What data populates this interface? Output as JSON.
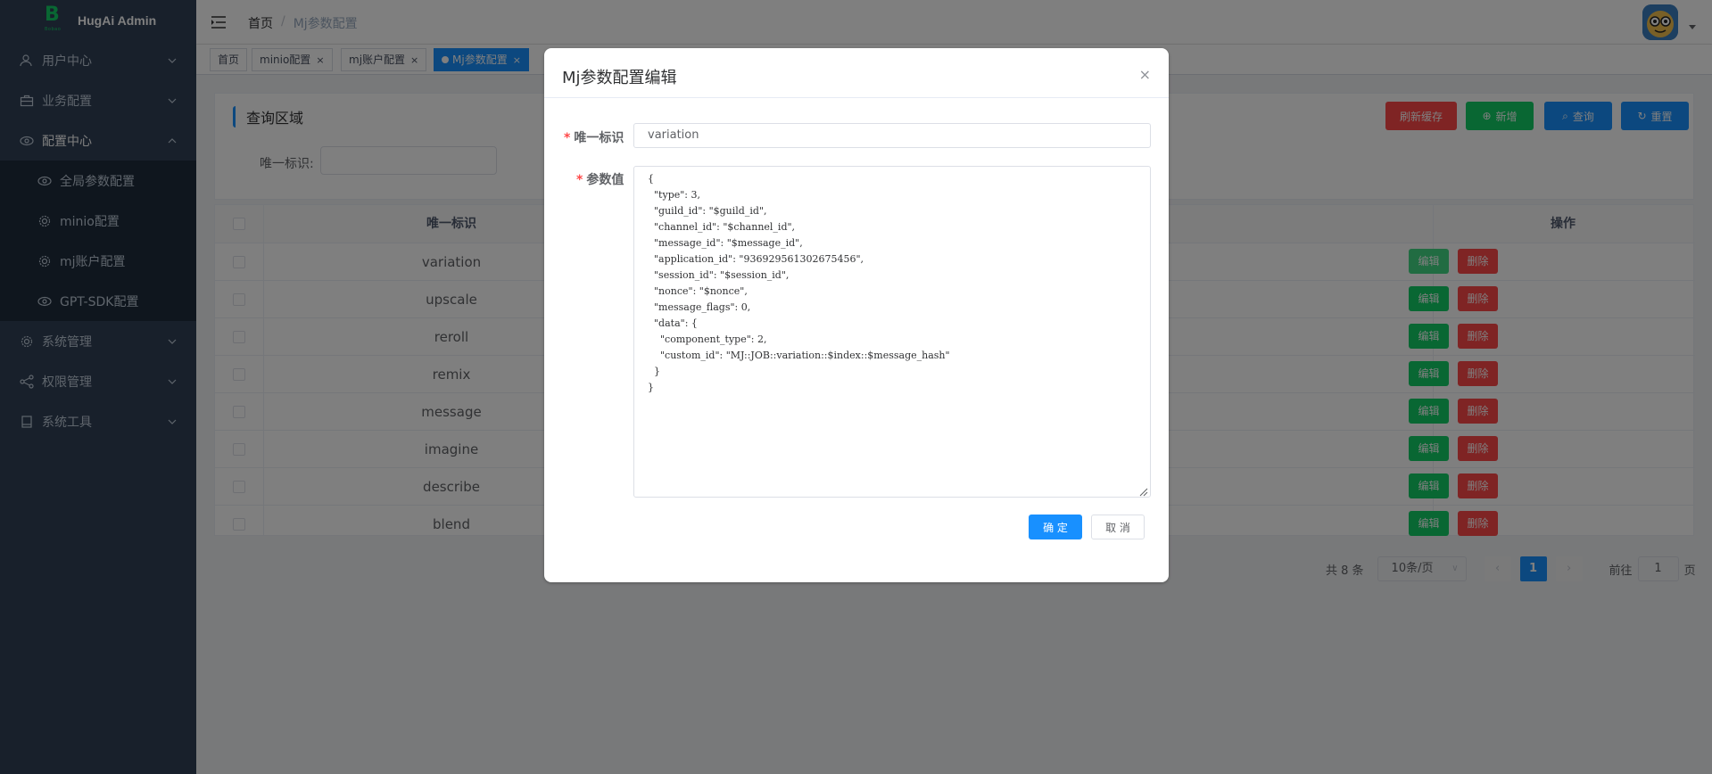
{
  "app": {
    "title": "HugAi Admin",
    "logo_letter": "B",
    "logo_sub": "Bobao"
  },
  "sidebar": {
    "items": [
      {
        "label": "用户中心",
        "icon": "user-icon"
      },
      {
        "label": "业务配置",
        "icon": "briefcase-icon"
      },
      {
        "label": "配置中心",
        "icon": "eye-icon"
      },
      {
        "label": "系统管理",
        "icon": "gear-icon"
      },
      {
        "label": "权限管理",
        "icon": "share-icon"
      },
      {
        "label": "系统工具",
        "icon": "printer-icon"
      }
    ],
    "config_sub": [
      {
        "label": "全局参数配置",
        "icon": "eye-icon"
      },
      {
        "label": "minio配置",
        "icon": "gear-icon"
      },
      {
        "label": "mj账户配置",
        "icon": "gear-icon"
      },
      {
        "label": "GPT-SDK配置",
        "icon": "eye-icon"
      }
    ]
  },
  "header": {
    "breadcrumb_home": "首页",
    "breadcrumb_sep": "/",
    "breadcrumb_current": "Mj参数配置"
  },
  "tags": [
    {
      "label": "首页"
    },
    {
      "label": "minio配置"
    },
    {
      "label": "mj账户配置"
    },
    {
      "label": "Mj参数配置"
    }
  ],
  "query": {
    "title": "查询区域",
    "label": "唯一标识:",
    "buttons": {
      "refresh": "刷新缓存",
      "add": "新增",
      "search": "查询",
      "reset": "重置"
    }
  },
  "table": {
    "headers": {
      "id": "唯一标识",
      "ops": "操作"
    },
    "edit_label": "编辑",
    "delete_label": "删除",
    "rows": [
      "variation",
      "upscale",
      "reroll",
      "remix",
      "message",
      "imagine",
      "describe",
      "blend"
    ]
  },
  "pagination": {
    "total": "共 8 条",
    "page_size": "10条/页",
    "current": "1",
    "goto_label": "前往",
    "goto_value": "1",
    "page_unit": "页"
  },
  "dialog": {
    "title": "Mj参数配置编辑",
    "id_label": "唯一标识",
    "id_value": "variation",
    "param_label": "参数值",
    "param_value": "{\n  \"type\": 3,\n  \"guild_id\": \"$guild_id\",\n  \"channel_id\": \"$channel_id\",\n  \"message_id\": \"$message_id\",\n  \"application_id\": \"936929561302675456\",\n  \"session_id\": \"$session_id\",\n  \"nonce\": \"$nonce\",\n  \"message_flags\": 0,\n  \"data\": {\n    \"component_type\": 2,\n    \"custom_id\": \"MJ::JOB::variation::$index::$message_hash\"\n  }\n}",
    "ok": "确 定",
    "cancel": "取 消",
    "close": "×"
  }
}
